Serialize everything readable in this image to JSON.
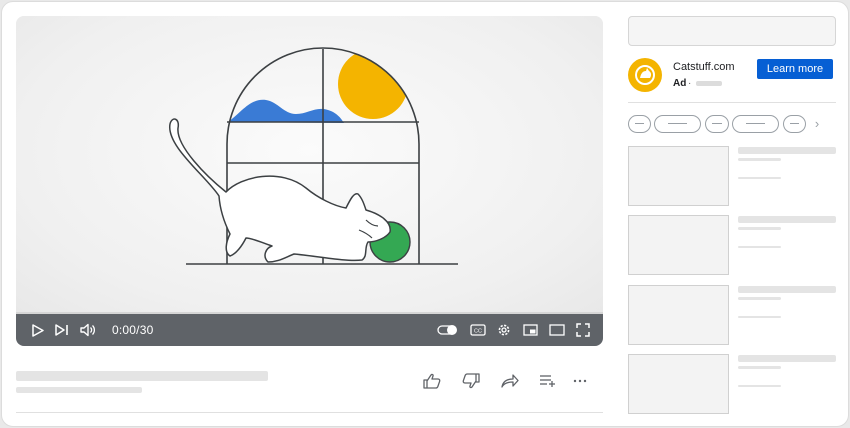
{
  "player": {
    "time": "0:00/30",
    "controls": [
      "play-icon",
      "next-icon",
      "volume-icon",
      "autoplay-toggle-icon",
      "captions-icon",
      "settings-icon",
      "miniplayer-icon",
      "theater-icon",
      "fullscreen-icon"
    ],
    "captions_label": "CC"
  },
  "video_actions": [
    "like-icon",
    "dislike-icon",
    "share-icon",
    "save-to-playlist-icon",
    "more-icon"
  ],
  "ad": {
    "title": "Catstuff.com",
    "label": "Ad",
    "separator": "·",
    "button": "Learn more",
    "brand_color": "#f4b400",
    "button_color": "#065fd4"
  },
  "chips_count": 5,
  "recommendations_count": 4,
  "colors": {
    "controls_bg": "#5f6368",
    "sky_blue": "#3a7bd5",
    "sun_yellow": "#f4b400",
    "ball_green": "#34a853"
  }
}
